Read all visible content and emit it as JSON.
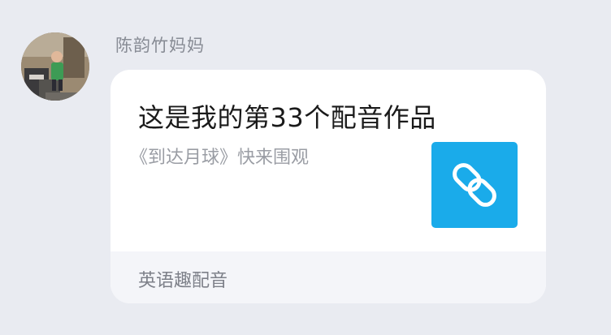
{
  "message": {
    "sender": {
      "name": "陈韵竹妈妈",
      "avatar_icon": "child-photo-avatar"
    },
    "link_card": {
      "title": "这是我的第33个配音作品",
      "description": "《到达月球》快来围观",
      "thumbnail_icon": "chain-link-icon",
      "thumbnail_color": "#1aabea",
      "source_app": "英语趣配音"
    }
  }
}
